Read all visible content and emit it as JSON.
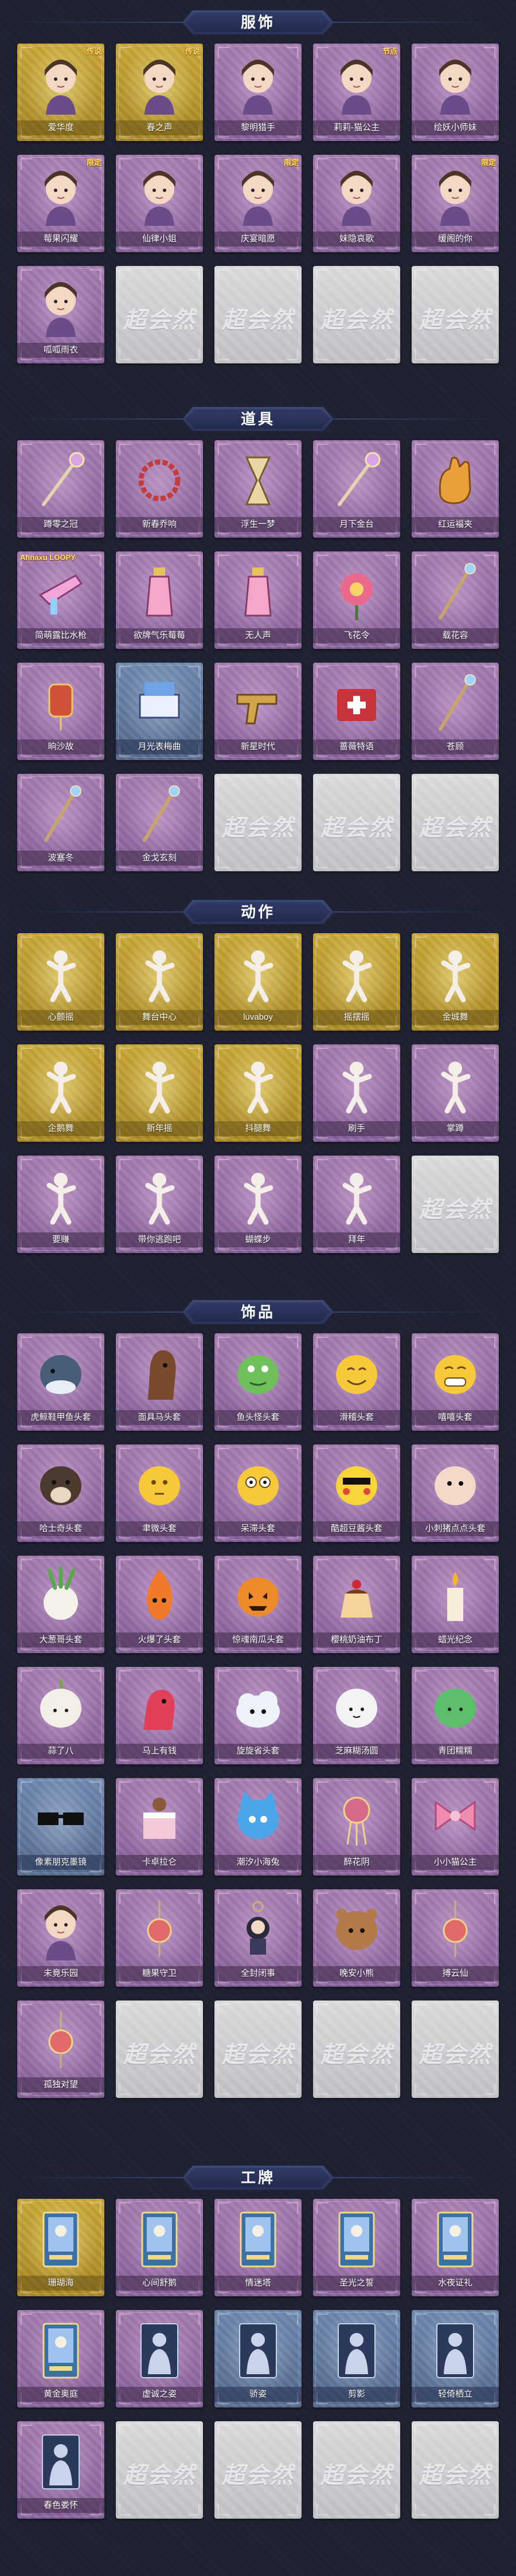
{
  "colors": {
    "page_background": "#1e2130",
    "header_plate": "#2f3a67",
    "rarity_gold": "#c9a835",
    "rarity_purple": "#a57bb0",
    "rarity_blue": "#6f88b0",
    "rarity_empty": "#cfcfd2"
  },
  "empty_logo": "超会然",
  "sections": [
    {
      "title": "服饰",
      "items": [
        {
          "name": "爱华度",
          "rarity": "gold",
          "icon": "costume-portrait-icon",
          "badge": "传说"
        },
        {
          "name": "春之声",
          "rarity": "gold",
          "icon": "costume-portrait-icon",
          "badge": "传说"
        },
        {
          "name": "黎明猎手",
          "rarity": "purple",
          "icon": "costume-portrait-icon",
          "badge": ""
        },
        {
          "name": "莉莉-猫公主",
          "rarity": "purple",
          "icon": "costume-portrait-icon",
          "badge": "节点"
        },
        {
          "name": "绘妖小师妹",
          "rarity": "purple",
          "icon": "costume-portrait-icon",
          "badge": ""
        },
        {
          "name": "莓果闪耀",
          "rarity": "purple",
          "icon": "costume-portrait-icon",
          "badge": "限定"
        },
        {
          "name": "仙律小姐",
          "rarity": "purple",
          "icon": "costume-portrait-icon",
          "badge": ""
        },
        {
          "name": "庆宴暗愿",
          "rarity": "purple",
          "icon": "costume-portrait-icon",
          "badge": "限定"
        },
        {
          "name": "妹隐哀歌",
          "rarity": "purple",
          "icon": "costume-portrait-icon",
          "badge": ""
        },
        {
          "name": "缓阁的你",
          "rarity": "purple",
          "icon": "costume-portrait-icon",
          "badge": "限定"
        },
        {
          "name": "呱呱雨衣",
          "rarity": "purple",
          "icon": "costume-portrait-icon",
          "badge": ""
        },
        {
          "name": "",
          "rarity": "empty",
          "icon": "",
          "badge": ""
        },
        {
          "name": "",
          "rarity": "empty",
          "icon": "",
          "badge": ""
        },
        {
          "name": "",
          "rarity": "empty",
          "icon": "",
          "badge": ""
        },
        {
          "name": "",
          "rarity": "empty",
          "icon": "",
          "badge": ""
        }
      ]
    },
    {
      "title": "道具",
      "items": [
        {
          "name": "蹲零之冠",
          "rarity": "purple",
          "icon": "wand-icon",
          "badge": ""
        },
        {
          "name": "新春乔响",
          "rarity": "purple",
          "icon": "beads-icon",
          "badge": ""
        },
        {
          "name": "浮生一梦",
          "rarity": "purple",
          "icon": "hourglass-icon",
          "badge": ""
        },
        {
          "name": "月下金台",
          "rarity": "purple",
          "icon": "wand-icon",
          "badge": ""
        },
        {
          "name": "红运福夹",
          "rarity": "purple",
          "icon": "glove-icon",
          "badge": ""
        },
        {
          "name": "简萌露比水枪",
          "rarity": "purple",
          "icon": "water-gun-icon",
          "badge": "Ahnaxu LOOPY"
        },
        {
          "name": "欲牌气乐莓莓",
          "rarity": "purple",
          "icon": "bottle-icon",
          "badge": ""
        },
        {
          "name": "无人声",
          "rarity": "purple",
          "icon": "bottle-icon",
          "badge": ""
        },
        {
          "name": "飞花令",
          "rarity": "purple",
          "icon": "flower-icon",
          "badge": ""
        },
        {
          "name": "载花容",
          "rarity": "purple",
          "icon": "staff-icon",
          "badge": ""
        },
        {
          "name": "晌沙故",
          "rarity": "purple",
          "icon": "lantern-icon",
          "badge": ""
        },
        {
          "name": "月光表梅曲",
          "rarity": "blue",
          "icon": "piano-icon",
          "badge": ""
        },
        {
          "name": "新星时代",
          "rarity": "purple",
          "icon": "gun-icon",
          "badge": ""
        },
        {
          "name": "蔷薇特语",
          "rarity": "purple",
          "icon": "medkit-icon",
          "badge": ""
        },
        {
          "name": "苍顾",
          "rarity": "purple",
          "icon": "staff-icon",
          "badge": ""
        },
        {
          "name": "波塞冬",
          "rarity": "purple",
          "icon": "staff-icon",
          "badge": ""
        },
        {
          "name": "金戈玄刻",
          "rarity": "purple",
          "icon": "staff-icon",
          "badge": ""
        },
        {
          "name": "",
          "rarity": "empty",
          "icon": "",
          "badge": ""
        },
        {
          "name": "",
          "rarity": "empty",
          "icon": "",
          "badge": ""
        },
        {
          "name": "",
          "rarity": "empty",
          "icon": "",
          "badge": ""
        }
      ]
    },
    {
      "title": "动作",
      "items": [
        {
          "name": "心颤摇",
          "rarity": "gold",
          "icon": "pose-icon",
          "badge": ""
        },
        {
          "name": "舞台中心",
          "rarity": "gold",
          "icon": "pose-icon",
          "badge": ""
        },
        {
          "name": "luvaboy",
          "rarity": "gold",
          "icon": "pose-icon",
          "badge": ""
        },
        {
          "name": "摇摆摇",
          "rarity": "gold",
          "icon": "pose-icon",
          "badge": ""
        },
        {
          "name": "金城舞",
          "rarity": "gold",
          "icon": "pose-icon",
          "badge": ""
        },
        {
          "name": "企鹅舞",
          "rarity": "gold",
          "icon": "pose-icon",
          "badge": ""
        },
        {
          "name": "新年摇",
          "rarity": "gold",
          "icon": "pose-icon",
          "badge": ""
        },
        {
          "name": "抖腿舞",
          "rarity": "gold",
          "icon": "pose-icon",
          "badge": ""
        },
        {
          "name": "刷手",
          "rarity": "purple",
          "icon": "pose-icon",
          "badge": ""
        },
        {
          "name": "掌蹲",
          "rarity": "purple",
          "icon": "pose-icon",
          "badge": ""
        },
        {
          "name": "要赚",
          "rarity": "purple",
          "icon": "pose-icon",
          "badge": ""
        },
        {
          "name": "带你逃跑吧",
          "rarity": "purple",
          "icon": "pose-icon",
          "badge": ""
        },
        {
          "name": "蝴蝶步",
          "rarity": "purple",
          "icon": "pose-icon",
          "badge": ""
        },
        {
          "name": "拜年",
          "rarity": "purple",
          "icon": "pose-icon",
          "badge": ""
        },
        {
          "name": "",
          "rarity": "empty",
          "icon": "",
          "badge": ""
        }
      ]
    },
    {
      "title": "饰品",
      "items": [
        {
          "name": "虎鲸鞋甲鱼头套",
          "rarity": "purple",
          "icon": "whale-head-icon",
          "badge": ""
        },
        {
          "name": "面具马头套",
          "rarity": "purple",
          "icon": "horse-head-icon",
          "badge": ""
        },
        {
          "name": "鱼头怪头套",
          "rarity": "purple",
          "icon": "fish-head-icon",
          "badge": ""
        },
        {
          "name": "滑稽头套",
          "rarity": "purple",
          "icon": "smile-face-icon",
          "badge": ""
        },
        {
          "name": "嘻嘻头套",
          "rarity": "purple",
          "icon": "grin-face-icon",
          "badge": ""
        },
        {
          "name": "哈士奇头套",
          "rarity": "purple",
          "icon": "dog-head-icon",
          "badge": ""
        },
        {
          "name": "聿微头套",
          "rarity": "purple",
          "icon": "plain-face-icon",
          "badge": ""
        },
        {
          "name": "呆滞头套",
          "rarity": "purple",
          "icon": "stare-face-icon",
          "badge": ""
        },
        {
          "name": "酷超豆酱头套",
          "rarity": "purple",
          "icon": "pikachu-head-icon",
          "badge": ""
        },
        {
          "name": "小刺猪点点头套",
          "rarity": "purple",
          "icon": "blob-head-icon",
          "badge": ""
        },
        {
          "name": "大葱哥头套",
          "rarity": "purple",
          "icon": "onion-head-icon",
          "badge": ""
        },
        {
          "name": "火爆了头套",
          "rarity": "purple",
          "icon": "fire-head-icon",
          "badge": ""
        },
        {
          "name": "惊魂南瓜头套",
          "rarity": "purple",
          "icon": "pumpkin-head-icon",
          "badge": ""
        },
        {
          "name": "樱桃奶油布丁",
          "rarity": "purple",
          "icon": "pudding-icon",
          "badge": ""
        },
        {
          "name": "蜡光纪念",
          "rarity": "purple",
          "icon": "candle-icon",
          "badge": ""
        },
        {
          "name": "蒜了八",
          "rarity": "purple",
          "icon": "garlic-icon",
          "badge": ""
        },
        {
          "name": "马上有钱",
          "rarity": "purple",
          "icon": "horse-toy-icon",
          "badge": ""
        },
        {
          "name": "旋旋省头套",
          "rarity": "purple",
          "icon": "cloud-head-icon",
          "badge": ""
        },
        {
          "name": "芝麻糊汤圆",
          "rarity": "purple",
          "icon": "dumpling-icon",
          "badge": ""
        },
        {
          "name": "青团糯糯",
          "rarity": "purple",
          "icon": "green-bun-icon",
          "badge": ""
        },
        {
          "name": "像素朋克墨镜",
          "rarity": "blue",
          "icon": "sunglasses-icon",
          "badge": ""
        },
        {
          "name": "卡卓拉仑",
          "rarity": "purple",
          "icon": "cake-icon",
          "badge": ""
        },
        {
          "name": "潮汐小海兔",
          "rarity": "purple",
          "icon": "blue-cat-icon",
          "badge": ""
        },
        {
          "name": "醉花阴",
          "rarity": "purple",
          "icon": "hairpin-icon",
          "badge": ""
        },
        {
          "name": "小小猫公主",
          "rarity": "purple",
          "icon": "bow-icon",
          "badge": ""
        },
        {
          "name": "未竟乐园",
          "rarity": "purple",
          "icon": "doll-icon",
          "badge": ""
        },
        {
          "name": "糖果守卫",
          "rarity": "purple",
          "icon": "pendant-icon",
          "badge": ""
        },
        {
          "name": "全封闭事",
          "rarity": "purple",
          "icon": "keychain-icon",
          "badge": ""
        },
        {
          "name": "晚安小熊",
          "rarity": "purple",
          "icon": "bear-icon",
          "badge": ""
        },
        {
          "name": "搏云仙",
          "rarity": "purple",
          "icon": "pendant-icon",
          "badge": ""
        },
        {
          "name": "孤独对望",
          "rarity": "purple",
          "icon": "pendant-icon",
          "badge": ""
        },
        {
          "name": "",
          "rarity": "empty",
          "icon": "",
          "badge": ""
        },
        {
          "name": "",
          "rarity": "empty",
          "icon": "",
          "badge": ""
        },
        {
          "name": "",
          "rarity": "empty",
          "icon": "",
          "badge": ""
        },
        {
          "name": "",
          "rarity": "empty",
          "icon": "",
          "badge": ""
        }
      ]
    },
    {
      "title": "工牌",
      "items": [
        {
          "name": "珊瑚海",
          "rarity": "gold",
          "icon": "card-badge-icon",
          "badge": ""
        },
        {
          "name": "心间舒鹅",
          "rarity": "purple",
          "icon": "card-badge-icon",
          "badge": ""
        },
        {
          "name": "情迷塔",
          "rarity": "purple",
          "icon": "card-badge-icon",
          "badge": ""
        },
        {
          "name": "圣光之誓",
          "rarity": "purple",
          "icon": "card-badge-icon",
          "badge": ""
        },
        {
          "name": "水夜证礼",
          "rarity": "purple",
          "icon": "card-badge-icon",
          "badge": ""
        },
        {
          "name": "黄金奥庭",
          "rarity": "purple",
          "icon": "card-badge-icon",
          "badge": ""
        },
        {
          "name": "虚诚之姿",
          "rarity": "purple",
          "icon": "silhouette-icon",
          "badge": ""
        },
        {
          "name": "骄姿",
          "rarity": "blue",
          "icon": "silhouette-icon",
          "badge": ""
        },
        {
          "name": "剪影",
          "rarity": "blue",
          "icon": "silhouette-icon",
          "badge": ""
        },
        {
          "name": "轻倚栖立",
          "rarity": "blue",
          "icon": "silhouette-icon",
          "badge": ""
        },
        {
          "name": "春色娄怀",
          "rarity": "purple",
          "icon": "silhouette-icon",
          "badge": ""
        },
        {
          "name": "",
          "rarity": "empty",
          "icon": "",
          "badge": ""
        },
        {
          "name": "",
          "rarity": "empty",
          "icon": "",
          "badge": ""
        },
        {
          "name": "",
          "rarity": "empty",
          "icon": "",
          "badge": ""
        },
        {
          "name": "",
          "rarity": "empty",
          "icon": "",
          "badge": ""
        }
      ]
    }
  ]
}
